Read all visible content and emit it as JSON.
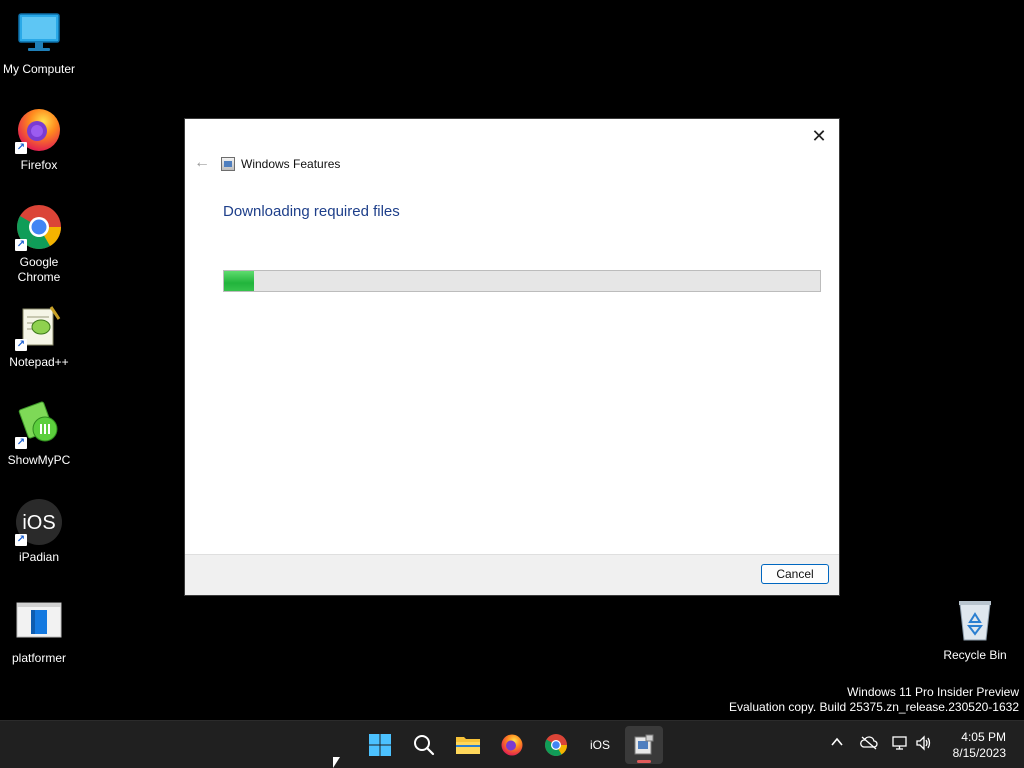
{
  "desktop": {
    "icons": [
      {
        "label": "My Computer",
        "icon": "computer-icon"
      },
      {
        "label": "Firefox",
        "icon": "firefox-icon"
      },
      {
        "label": "Google Chrome",
        "icon": "chrome-icon"
      },
      {
        "label": "Notepad++",
        "icon": "notepadpp-icon"
      },
      {
        "label": "ShowMyPC",
        "icon": "showmypc-icon"
      },
      {
        "label": "iPadian",
        "icon": "ipadian-icon",
        "glyph_text": "iOS"
      },
      {
        "label": "platformer",
        "icon": "platformer-icon"
      }
    ],
    "recycle_bin": {
      "label": "Recycle Bin",
      "icon": "recycle-bin-icon"
    }
  },
  "dialog": {
    "title": "Windows Features",
    "heading": "Downloading required files",
    "progress": 0.05,
    "cancel_label": "Cancel",
    "close_glyph": "✕",
    "back_glyph": "←"
  },
  "watermark": {
    "line1": "Windows 11 Pro Insider Preview",
    "line2": "Evaluation copy. Build 25375.zn_release.230520-1632"
  },
  "taskbar": {
    "apps": [
      {
        "name": "start-button",
        "icon": "windows-logo-icon"
      },
      {
        "name": "search-button",
        "icon": "search-icon"
      },
      {
        "name": "file-explorer-button",
        "icon": "folder-icon"
      },
      {
        "name": "firefox-taskbar-button",
        "icon": "firefox-icon"
      },
      {
        "name": "chrome-taskbar-button",
        "icon": "chrome-icon"
      },
      {
        "name": "ipadian-taskbar-button",
        "icon": "ipadian-icon",
        "text": "iOS"
      },
      {
        "name": "windows-features-taskbar-button",
        "icon": "windows-features-icon",
        "active": true
      }
    ],
    "clock_time": "4:05 PM",
    "clock_date": "8/15/2023"
  },
  "colors": {
    "accent_blue": "#0067c0",
    "heading_blue": "#1e3f8a",
    "progress_green": "#22b43c",
    "taskbar_bg": "#202020",
    "active_indicator": "#e05a5a"
  }
}
